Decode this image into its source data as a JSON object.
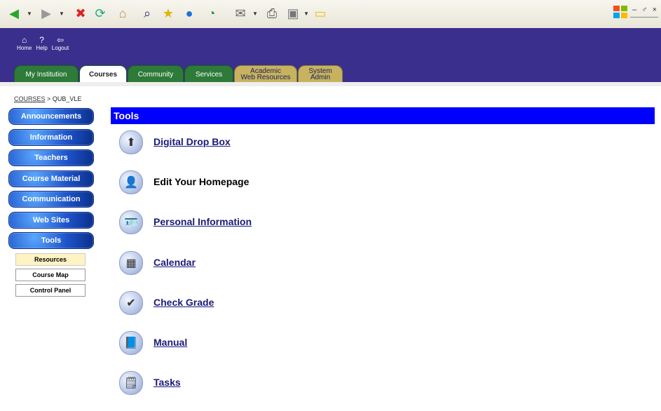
{
  "toolbar": {
    "icons": [
      "back-icon",
      "forward-icon",
      "stop-icon",
      "refresh-icon",
      "home-icon",
      "search-icon",
      "favorites-icon",
      "media-icon",
      "history-icon",
      "mail-icon",
      "print-icon",
      "edit-icon",
      "notes-icon"
    ]
  },
  "window_controls": {
    "text": "– ♂ ×"
  },
  "header": {
    "top_icons": [
      {
        "label": "Home"
      },
      {
        "label": "Help"
      },
      {
        "label": "Logout"
      }
    ],
    "tabs": [
      {
        "label": "My Institution"
      },
      {
        "label": "Courses"
      },
      {
        "label": "Community"
      },
      {
        "label": "Services"
      },
      {
        "label": "Academic\nWeb Resources"
      },
      {
        "label": "System\nAdmin"
      }
    ]
  },
  "breadcrumb": {
    "root": "COURSES",
    "separator": ">",
    "current": "QUB_VLE"
  },
  "leftnav": {
    "items": [
      {
        "label": "Announcements"
      },
      {
        "label": "Information"
      },
      {
        "label": "Teachers"
      },
      {
        "label": "Course Material"
      },
      {
        "label": "Communication"
      },
      {
        "label": "Web Sites"
      },
      {
        "label": "Tools"
      }
    ],
    "subitems": [
      {
        "label": "Resources",
        "selected": true
      },
      {
        "label": "Course Map"
      },
      {
        "label": "Control Panel"
      }
    ]
  },
  "main": {
    "title": "Tools",
    "tools": [
      {
        "label": "Digital Drop Box",
        "link": true
      },
      {
        "label": "Edit Your Homepage",
        "link": false
      },
      {
        "label": "Personal Information",
        "link": true
      },
      {
        "label": "Calendar",
        "link": true
      },
      {
        "label": "Check Grade",
        "link": true
      },
      {
        "label": "Manual",
        "link": true
      },
      {
        "label": "Tasks",
        "link": true
      }
    ]
  }
}
